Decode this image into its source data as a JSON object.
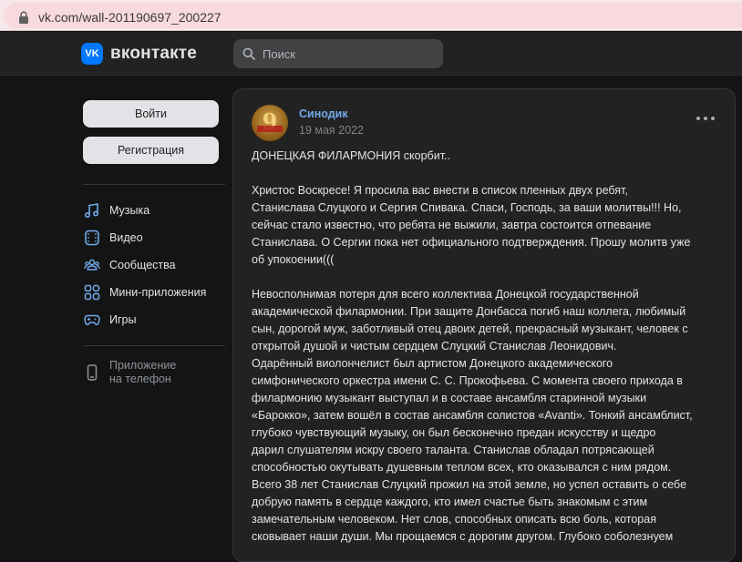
{
  "browser": {
    "url": "vk.com/wall-201190697_200227"
  },
  "header": {
    "logo_text": "вконтакте",
    "logo_mark": "VK",
    "search_placeholder": "Поиск"
  },
  "sidebar": {
    "login_label": "Войти",
    "register_label": "Регистрация",
    "nav": [
      {
        "label": "Музыка",
        "icon": "music-icon"
      },
      {
        "label": "Видео",
        "icon": "video-icon"
      },
      {
        "label": "Сообщества",
        "icon": "communities-icon"
      },
      {
        "label": "Мини-приложения",
        "icon": "mini-apps-icon"
      },
      {
        "label": "Игры",
        "icon": "games-icon"
      }
    ],
    "app_line1": "Приложение",
    "app_line2": "на телефон"
  },
  "post": {
    "author": "Синодик",
    "date": "19 мая 2022",
    "lines": [
      "ДОНЕЦКАЯ ФИЛАРМОНИЯ скорбит..",
      "",
      "Христос Воскресе! Я просила вас внести в список пленных двух ребят,",
      "Станислава Слуцкого и Сергия Спивака. Спаси, Господь, за ваши молитвы!!! Но,",
      "сейчас стало известно, что ребята не выжили, завтра состоится отпевание",
      "Станислава. О Сергии пока нет официального подтверждения. Прошу молитв уже",
      "об упокоении(((",
      "",
      "Невосполнимая потеря для всего коллектива Донецкой государственной",
      "академической филармонии. При защите Донбасса погиб наш коллега, любимый",
      "сын, дорогой муж, заботливый отец двоих детей, прекрасный музыкант, человек с",
      "открытой душой и чистым сердцем Слуцкий Станислав Леонидович.",
      "Одарённый виолончелист был артистом Донецкого академического",
      "симфонического оркестра имени С. С. Прокофьева. С момента своего прихода в",
      "филармонию музыкант выступал и в составе ансамбля старинной музыки",
      "«Барокко», затем вошёл в состав ансамбля солистов «Avanti». Тонкий ансамблист,",
      "глубоко чувствующий музыку, он был бесконечно предан искусству и щедро",
      "дарил слушателям искру своего таланта. Станислав обладал потрясающей",
      "способностью окутывать душевным теплом всех, кто оказывался с ним рядом.",
      "Всего 38 лет Станислав Слуцкий прожил на этой земле, но успел оставить о себе",
      "добрую память в сердце каждого, кто имел счастье быть знакомым с этим",
      "замечательным человеком. Нет слов, способных описать всю боль, которая",
      "сковывает наши души. Мы прощаемся с дорогим другом. Глубоко соболезнуем"
    ]
  },
  "colors": {
    "accent": "#0077ff",
    "link": "#71aaeb",
    "background": "#141414",
    "panel": "#222222"
  }
}
